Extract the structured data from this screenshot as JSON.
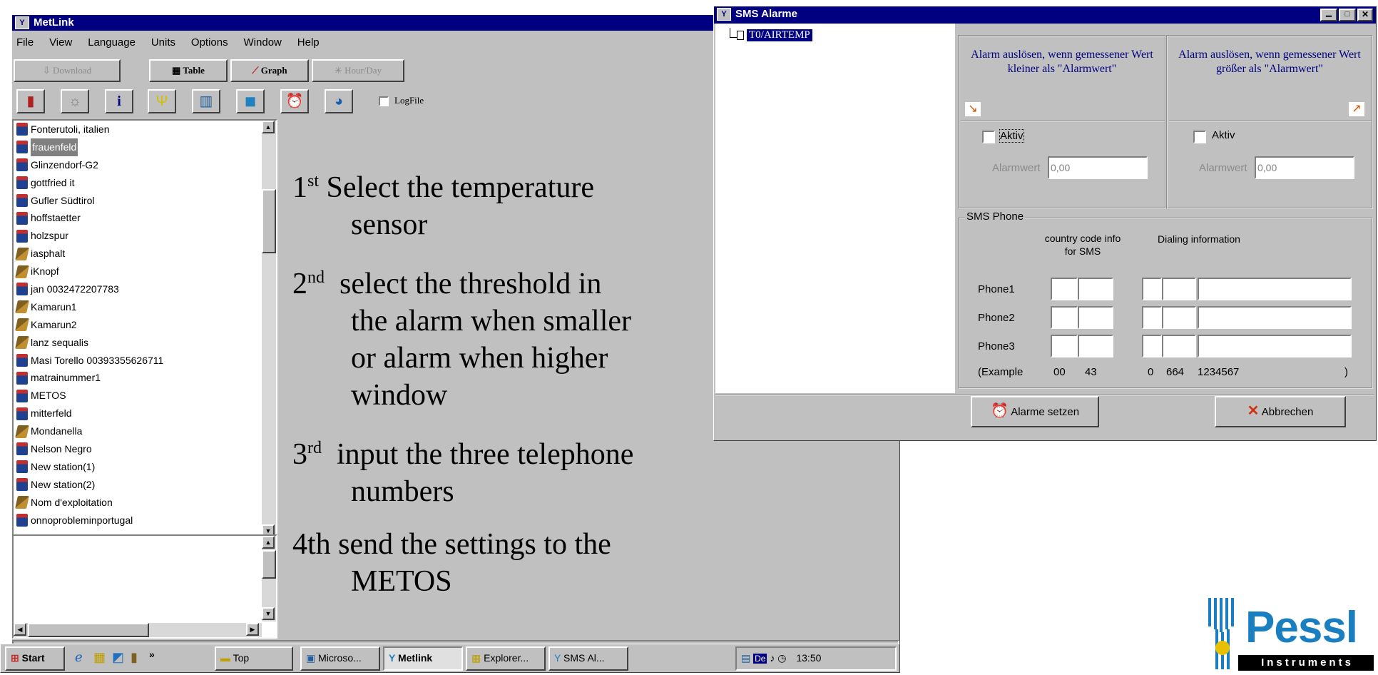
{
  "metlink": {
    "title": "MetLink",
    "menu": [
      "File",
      "View",
      "Language",
      "Units",
      "Options",
      "Window",
      "Help"
    ],
    "toolbar": {
      "download": "Download",
      "table": "Table",
      "graph": "Graph",
      "hourday": "Hour/Day"
    },
    "logfile_label": "LogFile",
    "stations": [
      {
        "label": "Fonterutoli, italien",
        "type": "station"
      },
      {
        "label": "frauenfeld",
        "type": "station",
        "selected": true
      },
      {
        "label": "Glinzendorf-G2",
        "type": "station"
      },
      {
        "label": "gottfried it",
        "type": "station"
      },
      {
        "label": "Gufler Südtirol",
        "type": "station"
      },
      {
        "label": "hoffstaetter",
        "type": "station"
      },
      {
        "label": "holzspur",
        "type": "station"
      },
      {
        "label": "iasphalt",
        "type": "tool"
      },
      {
        "label": "iKnopf",
        "type": "tool"
      },
      {
        "label": "jan 0032472207783",
        "type": "station"
      },
      {
        "label": "Kamarun1",
        "type": "tool"
      },
      {
        "label": "Kamarun2",
        "type": "tool"
      },
      {
        "label": "lanz sequalis",
        "type": "tool"
      },
      {
        "label": "Masi Torello 00393355626711",
        "type": "station"
      },
      {
        "label": "matrainummer1",
        "type": "station"
      },
      {
        "label": "METOS",
        "type": "station"
      },
      {
        "label": "mitterfeld",
        "type": "station"
      },
      {
        "label": "Mondanella",
        "type": "tool"
      },
      {
        "label": "Nelson Negro",
        "type": "station"
      },
      {
        "label": "New station(1)",
        "type": "station"
      },
      {
        "label": "New station(2)",
        "type": "station"
      },
      {
        "label": "Nom d'exploitation",
        "type": "tool"
      },
      {
        "label": "onnoprobleminportugal",
        "type": "station"
      }
    ]
  },
  "instructions": {
    "s1_num": "1",
    "s1_sup": "st",
    "s1_l1": "Select the temperature",
    "s1_l2": "sensor",
    "s2_num": "2",
    "s2_sup": "nd",
    "s2_l1": "select the threshold in",
    "s2_l2": "the alarm when smaller",
    "s2_l3": "or alarm when higher",
    "s2_l4": "window",
    "s3_num": "3",
    "s3_sup": "rd",
    "s3_l1": "input the three telephone",
    "s3_l2": "numbers",
    "s4_num": "4th",
    "s4_l1": "send the settings to the",
    "s4_l2": "METOS"
  },
  "sms": {
    "title": "SMS Alarme",
    "tree_item": "T0/AIRTEMP",
    "low_text": "Alarm auslösen, wenn gemessener Wert kleiner als \"Alarmwert\"",
    "high_text": "Alarm auslösen, wenn gemessener Wert größer als \"Alarmwert\"",
    "aktiv": "Aktiv",
    "alarmwert_label": "Alarmwert",
    "alarmwert_low": "0,00",
    "alarmwert_high": "0,00",
    "phone_group": "SMS Phone",
    "col_country": "country code info for SMS",
    "col_dialing": "Dialing information",
    "phone1": "Phone1",
    "phone2": "Phone2",
    "phone3": "Phone3",
    "example_label": "(Example",
    "ex_cc1": "00",
    "ex_cc2": "43",
    "ex_d1": "0",
    "ex_d2": "664",
    "ex_d3": "1234567",
    "ex_close": ")",
    "set_button": "Alarme setzen",
    "cancel_button": "Abbrechen"
  },
  "taskbar": {
    "start": "Start",
    "tasks": [
      "Top",
      "Microso...",
      "Metlink",
      "Explorer...",
      "SMS Al..."
    ],
    "clock": "13:50",
    "tray_label": "De"
  },
  "logo": {
    "brand": "Pessl",
    "sub": "Instruments"
  },
  "colors": {
    "titlebar": "#000080",
    "face": "#c0c0c0",
    "logo_blue": "#1a7fc0"
  }
}
